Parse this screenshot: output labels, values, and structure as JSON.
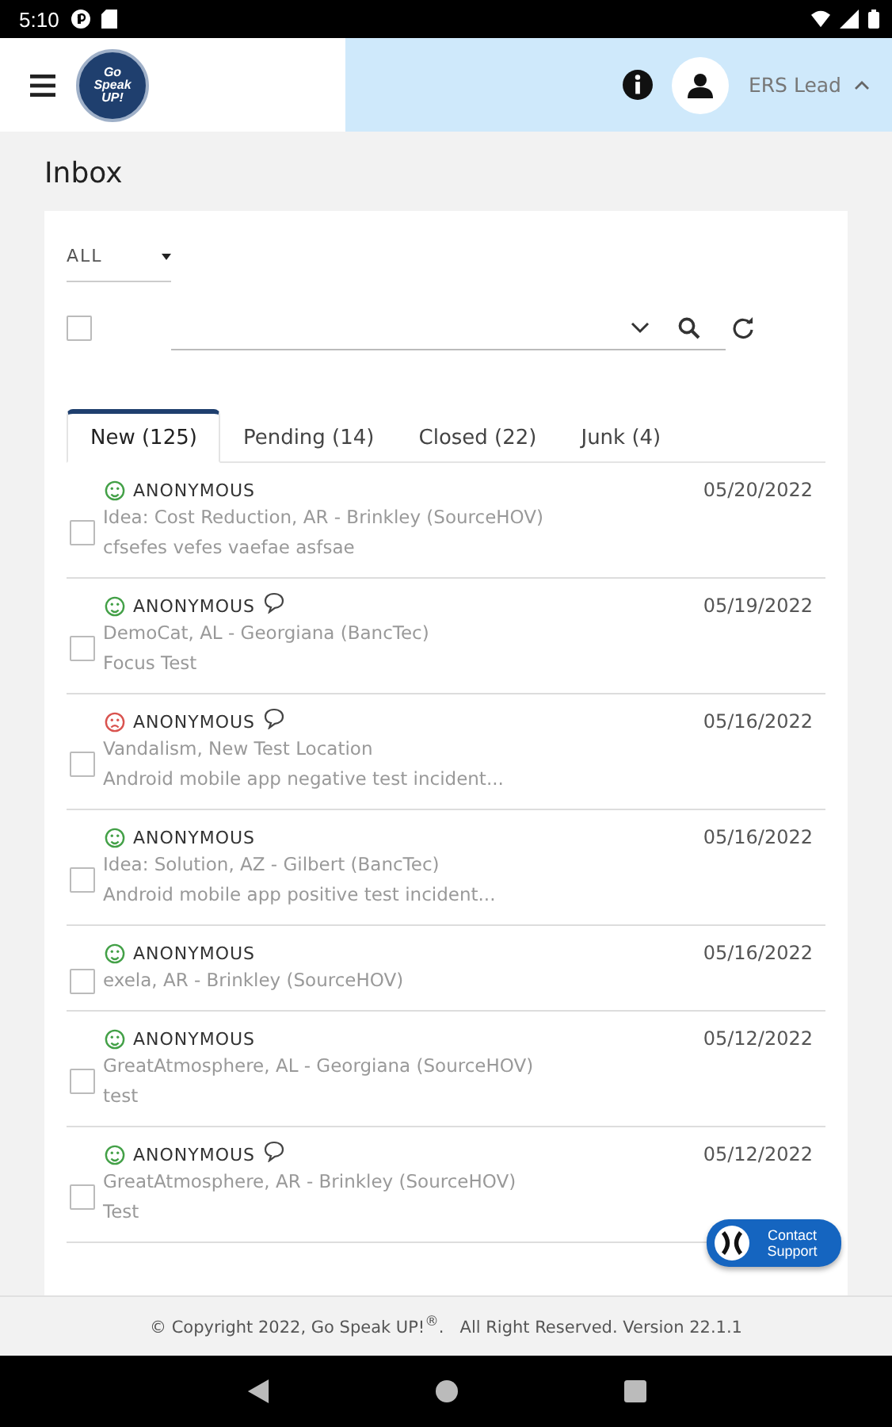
{
  "status_bar": {
    "time": "5:10"
  },
  "header": {
    "logo": {
      "lines": [
        "Go",
        "Speak",
        "UP!"
      ]
    },
    "user": {
      "role": "ERS Lead",
      "expanded": true
    }
  },
  "page": {
    "title": "Inbox"
  },
  "filter": {
    "value": "ALL"
  },
  "select_all": {
    "checked": false
  },
  "tabs": [
    {
      "label": "New (125)",
      "selected": true
    },
    {
      "label": "Pending (14)",
      "selected": false
    },
    {
      "label": "Closed (22)",
      "selected": false
    },
    {
      "label": "Junk (4)",
      "selected": false
    }
  ],
  "messages": [
    {
      "sender": "ANONYMOUS",
      "kind": "positive",
      "has_comment": false,
      "date": "05/20/2022",
      "subject": "Idea: Cost Reduction, AR - Brinkley (SourceHOV)",
      "preview": "cfsefes vefes vaefae asfsae",
      "checked": false
    },
    {
      "sender": "ANONYMOUS",
      "kind": "positive",
      "has_comment": true,
      "date": "05/19/2022",
      "subject": "DemoCat, AL - Georgiana (BancTec)",
      "preview": "Focus Test",
      "checked": false
    },
    {
      "sender": "ANONYMOUS",
      "kind": "negative",
      "has_comment": true,
      "date": "05/16/2022",
      "subject": "Vandalism, New Test Location",
      "preview": "Android mobile app negative test incident...",
      "checked": false
    },
    {
      "sender": "ANONYMOUS",
      "kind": "positive",
      "has_comment": false,
      "date": "05/16/2022",
      "subject": "Idea: Solution, AZ - Gilbert (BancTec)",
      "preview": "Android mobile app positive test incident...",
      "checked": false
    },
    {
      "sender": "ANONYMOUS",
      "kind": "positive",
      "has_comment": false,
      "date": "05/16/2022",
      "subject": "exela, AR - Brinkley (SourceHOV)",
      "checked": false
    },
    {
      "sender": "ANONYMOUS",
      "kind": "positive",
      "has_comment": false,
      "date": "05/12/2022",
      "subject": "GreatAtmosphere, AL - Georgiana (SourceHOV)",
      "preview": "test",
      "checked": false
    },
    {
      "sender": "ANONYMOUS",
      "kind": "positive",
      "has_comment": true,
      "date": "05/12/2022",
      "subject": "GreatAtmosphere, AR - Brinkley (SourceHOV)",
      "preview": "Test",
      "checked": false
    }
  ],
  "contact_button": {
    "label": "Contact Support"
  },
  "footer": {
    "text": "© Copyright 2022, Go Speak UP!$^{®}$.   All Right Reserved. Version 22.1.1"
  }
}
